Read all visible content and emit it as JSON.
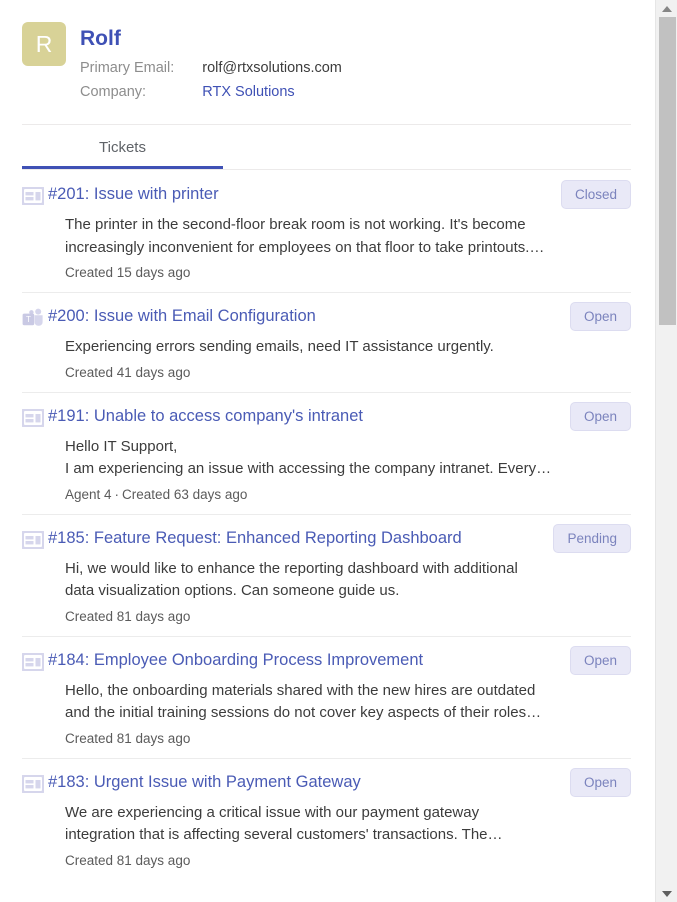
{
  "contact": {
    "avatar_initial": "R",
    "avatar_color": "#d8d297",
    "name": "Rolf",
    "fields": [
      {
        "label": "Primary Email:",
        "value": "rolf@rtxsolutions.com",
        "is_link": false
      },
      {
        "label": "Company:",
        "value": "RTX Solutions",
        "is_link": true
      }
    ]
  },
  "tabs": [
    {
      "label": "Tickets",
      "active": true
    }
  ],
  "accent_color": "#3f51b5",
  "tickets": [
    {
      "icon": "web-form-icon",
      "title": "#201: Issue with printer",
      "status": "Closed",
      "body": [
        "The printer in the second-floor break room is not working. It's become",
        "increasingly inconvenient for employees on that floor to take printouts.…"
      ],
      "agent": "",
      "created": "Created 15 days ago"
    },
    {
      "icon": "microsoft-teams-icon",
      "title": "#200: Issue with Email Configuration",
      "status": "Open",
      "body": [
        "Experiencing errors sending emails, need IT assistance urgently."
      ],
      "agent": "",
      "created": "Created 41 days ago"
    },
    {
      "icon": "web-form-icon",
      "title": "#191: Unable to access company's intranet",
      "status": "Open",
      "body": [
        "Hello IT Support,",
        "I am experiencing an issue with accessing the company intranet. Every…"
      ],
      "agent": "Agent 4",
      "created": "Created 63 days ago"
    },
    {
      "icon": "web-form-icon",
      "title": "#185: Feature Request: Enhanced Reporting Dashboard",
      "status": "Pending",
      "body": [
        "Hi, we would like to enhance the reporting dashboard with additional",
        "data visualization options. Can someone guide us."
      ],
      "agent": "",
      "created": "Created 81 days ago"
    },
    {
      "icon": "web-form-icon",
      "title": "#184: Employee Onboarding Process Improvement",
      "status": "Open",
      "body": [
        "Hello, the onboarding materials shared with the new hires are outdated",
        "and the initial training sessions do not cover key aspects of their roles…"
      ],
      "agent": "",
      "created": "Created 81 days ago"
    },
    {
      "icon": "web-form-icon",
      "title": "#183: Urgent Issue with Payment Gateway",
      "status": "Open",
      "body": [
        "We are experiencing a critical issue with our payment gateway",
        "integration that is affecting several customers' transactions. The…"
      ],
      "agent": "",
      "created": "Created 81 days ago"
    }
  ],
  "scrollbar": {
    "up_arrow": "scroll-up-arrow",
    "down_arrow": "scroll-down-arrow"
  }
}
